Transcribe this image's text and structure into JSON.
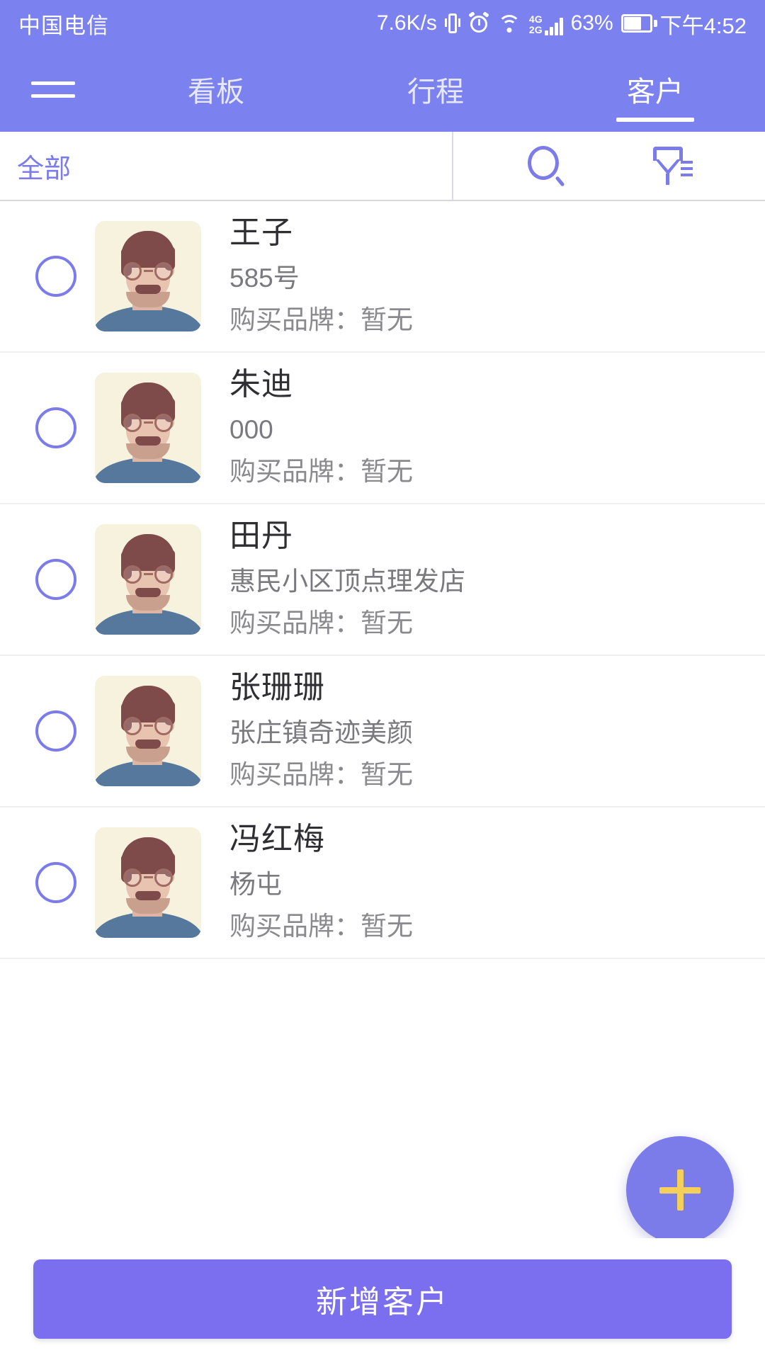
{
  "status_bar": {
    "carrier": "中国电信",
    "network_speed": "7.6K/s",
    "network_type_top": "4G",
    "network_type_bottom": "2G",
    "battery_percent": "63%",
    "clock": "下午4:52",
    "icons": [
      "vibrate-icon",
      "alarm-icon",
      "wifi-icon",
      "signal-icon",
      "battery-icon"
    ]
  },
  "app_bar": {
    "menu_icon": "hamburger-menu-icon",
    "tabs": [
      {
        "label": "看板",
        "active": false
      },
      {
        "label": "行程",
        "active": false
      },
      {
        "label": "客户",
        "active": true
      }
    ]
  },
  "filter_bar": {
    "selected_filter": "全部",
    "search_icon": "search-icon",
    "filter_icon": "filter-funnel-icon"
  },
  "customer_list": {
    "brand_label": "购买品牌：",
    "items": [
      {
        "name": "王子",
        "detail": "585号",
        "brand": "购买品牌：暂无",
        "selected": false
      },
      {
        "name": "朱迪",
        "detail": "000",
        "brand": "购买品牌：暂无",
        "selected": false
      },
      {
        "name": "田丹",
        "detail": "惠民小区顶点理发店",
        "brand": "购买品牌：暂无",
        "selected": false
      },
      {
        "name": "张珊珊",
        "detail": "张庄镇奇迹美颜",
        "brand": "购买品牌：暂无",
        "selected": false
      },
      {
        "name": "冯红梅",
        "detail": "杨屯",
        "brand": "购买品牌：暂无",
        "selected": false
      }
    ]
  },
  "fab": {
    "icon": "plus-icon",
    "label": ""
  },
  "bottom_bar": {
    "primary_button_label": "新增客户"
  },
  "colors": {
    "brand_purple": "#7b82f0",
    "accent_purple": "#7b7bea",
    "button_purple": "#7b6ff0",
    "fab_plus_yellow": "#f5cf5c",
    "text_primary": "#2f2f33",
    "text_secondary": "#7a7a7e",
    "avatar_bg": "#f6f2dd"
  }
}
